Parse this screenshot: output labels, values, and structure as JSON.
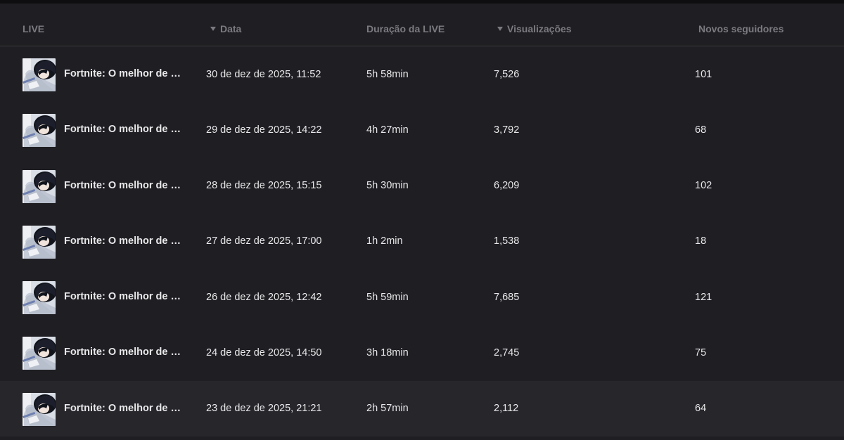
{
  "table": {
    "headers": {
      "live": "LIVE",
      "date": "Data",
      "duration": "Duração da LIVE",
      "views": "Visualizações",
      "followers": "Novos seguidores"
    },
    "rows": [
      {
        "title": "Fortnite: O melhor de pe...",
        "date": "30 de dez de 2025, 11:52",
        "duration": "5h 58min",
        "views": "7,526",
        "followers": "101"
      },
      {
        "title": "Fortnite: O melhor de pe...",
        "date": "29 de dez de 2025, 14:22",
        "duration": "4h 27min",
        "views": "3,792",
        "followers": "68"
      },
      {
        "title": "Fortnite: O melhor de pe...",
        "date": "28 de dez de 2025, 15:15",
        "duration": "5h 30min",
        "views": "6,209",
        "followers": "102"
      },
      {
        "title": "Fortnite: O melhor de pe...",
        "date": "27 de dez de 2025, 17:00",
        "duration": "1h 2min",
        "views": "1,538",
        "followers": "18"
      },
      {
        "title": "Fortnite: O melhor de pe...",
        "date": "26 de dez de 2025, 12:42",
        "duration": "5h 59min",
        "views": "7,685",
        "followers": "121"
      },
      {
        "title": "Fortnite: O melhor de pe...",
        "date": "24 de dez de 2025, 14:50",
        "duration": "3h 18min",
        "views": "2,745",
        "followers": "75"
      },
      {
        "title": "Fortnite: O melhor de pe...",
        "date": "23 de dez de 2025, 21:21",
        "duration": "2h 57min",
        "views": "2,112",
        "followers": "64"
      }
    ]
  }
}
